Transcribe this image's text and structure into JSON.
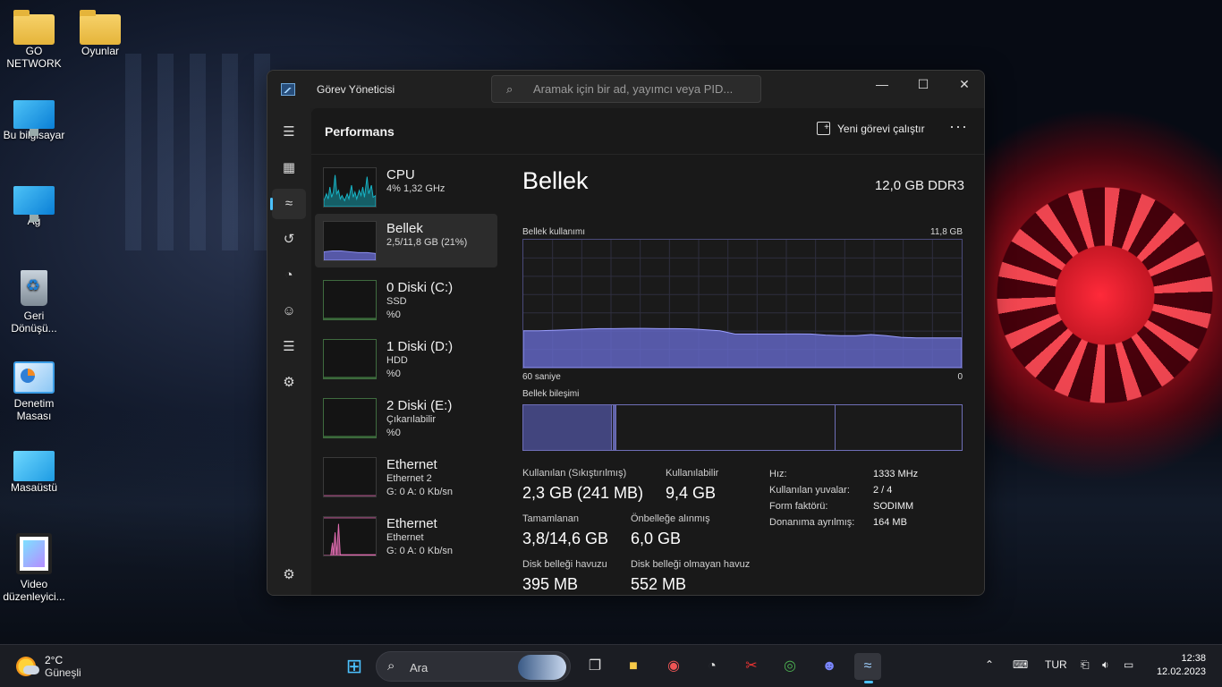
{
  "desktop": {
    "icons": [
      {
        "label": "GO NETWORK"
      },
      {
        "label": "Oyunlar"
      },
      {
        "label": "Bu bilgisayar"
      },
      {
        "label": "Ağ"
      },
      {
        "label": "Geri Dönüşü..."
      },
      {
        "label": "Denetim Masası"
      },
      {
        "label": "Masaüstü"
      },
      {
        "label": "Video düzenleyici..."
      }
    ]
  },
  "window": {
    "title": "Görev Yöneticisi",
    "search_placeholder": "Aramak için bir ad, yayımcı veya PID...",
    "controls": {
      "minimize": "—",
      "maximize": "☐",
      "close": "✕"
    }
  },
  "header": {
    "title": "Performans",
    "run_task": "Yeni görevi çalıştır",
    "more": "···"
  },
  "perf_list": [
    {
      "name": "CPU",
      "sub1": "4% 1,32 GHz",
      "sub2": "",
      "color": "#17b7c9"
    },
    {
      "name": "Bellek",
      "sub1": "2,5/11,8 GB (21%)",
      "sub2": "",
      "color": "#6c6fd8"
    },
    {
      "name": "0 Diski (C:)",
      "sub1": "SSD",
      "sub2": "%0",
      "color": "#5cb85c"
    },
    {
      "name": "1 Diski (D:)",
      "sub1": "HDD",
      "sub2": "%0",
      "color": "#5cb85c"
    },
    {
      "name": "2 Diski (E:)",
      "sub1": "Çıkarılabilir",
      "sub2": "%0",
      "color": "#5cb85c"
    },
    {
      "name": "Ethernet",
      "sub1": "Ethernet 2",
      "sub2": "G: 0 A: 0 Kb/sn",
      "color": "#e06cb0"
    },
    {
      "name": "Ethernet",
      "sub1": "Ethernet",
      "sub2": "G: 0 A: 0 Kb/sn",
      "color": "#e06cb0"
    }
  ],
  "memory": {
    "title": "Bellek",
    "type": "12,0 GB DDR3",
    "usage_label": "Bellek kullanımı",
    "usage_max": "11,8 GB",
    "time_label": "60 saniye",
    "zero_label": "0",
    "composition_label": "Bellek bileşimi",
    "usage_history_gb": [
      3.4,
      3.4,
      3.45,
      3.5,
      3.55,
      3.6,
      3.6,
      3.62,
      3.62,
      3.6,
      3.6,
      3.58,
      3.5,
      3.4,
      3.1,
      3.1,
      3.1,
      3.1,
      3.12,
      3.1,
      3.0,
      2.95,
      2.95,
      3.05,
      2.95,
      2.8,
      2.75,
      2.75,
      2.75,
      2.75
    ],
    "usage_scale_gb": 11.8,
    "composition_fraction": {
      "in_use": 0.205,
      "modified": 0.007,
      "standby": 0.5
    },
    "stats": {
      "in_use_label": "Kullanılan (Sıkıştırılmış)",
      "in_use_value": "2,3 GB (241 MB)",
      "available_label": "Kullanılabilir",
      "available_value": "9,4 GB",
      "committed_label": "Tamamlanan",
      "committed_value": "3,8/14,6 GB",
      "cached_label": "Önbelleğe alınmış",
      "cached_value": "6,0 GB",
      "paged_label": "Disk belleği havuzu",
      "paged_value": "395 MB",
      "nonpaged_label": "Disk belleği olmayan havuz",
      "nonpaged_value": "552 MB"
    },
    "specs": [
      {
        "k": "Hız:",
        "v": "1333 MHz"
      },
      {
        "k": "Kullanılan yuvalar:",
        "v": "2 / 4"
      },
      {
        "k": "Form faktörü:",
        "v": "SODIMM"
      },
      {
        "k": "Donanıma ayrılmış:",
        "v": "164 MB"
      }
    ]
  },
  "taskbar": {
    "weather_temp": "2°C",
    "weather_desc": "Güneşli",
    "search_label": "Ara",
    "lang": "TUR",
    "time": "12:38",
    "date": "12.02.2023"
  }
}
